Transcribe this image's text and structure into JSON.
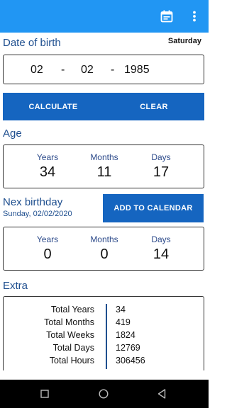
{
  "toolbar": {
    "calendar_icon": "calendar-icon",
    "more_icon": "more-vert-icon",
    "color": "#2196f3"
  },
  "dob": {
    "title": "Date of birth",
    "weekday": "Saturday",
    "day": "02",
    "sep1": "-",
    "month": "02",
    "sep2": "-",
    "year": "1985"
  },
  "actions": {
    "calculate": "CALCULATE",
    "clear": "CLEAR",
    "color": "#1565c0"
  },
  "age": {
    "title": "Age",
    "years_label": "Years",
    "years": "34",
    "months_label": "Months",
    "months": "11",
    "days_label": "Days",
    "days": "17"
  },
  "next_birthday": {
    "title": "Nex birthday",
    "date": "Sunday, 02/02/2020",
    "add_button": "ADD TO CALENDAR",
    "years_label": "Years",
    "years": "0",
    "months_label": "Months",
    "months": "0",
    "days_label": "Days",
    "days": "14"
  },
  "extra": {
    "title": "Extra",
    "rows": [
      {
        "label": "Total Years",
        "value": "34"
      },
      {
        "label": "Total Months",
        "value": "419"
      },
      {
        "label": "Total Weeks",
        "value": "1824"
      },
      {
        "label": "Total Days",
        "value": "12769"
      },
      {
        "label": "Total Hours",
        "value": "306456"
      }
    ]
  },
  "navbar": {
    "recents_icon": "square-icon",
    "home_icon": "circle-icon",
    "back_icon": "triangle-back-icon"
  }
}
